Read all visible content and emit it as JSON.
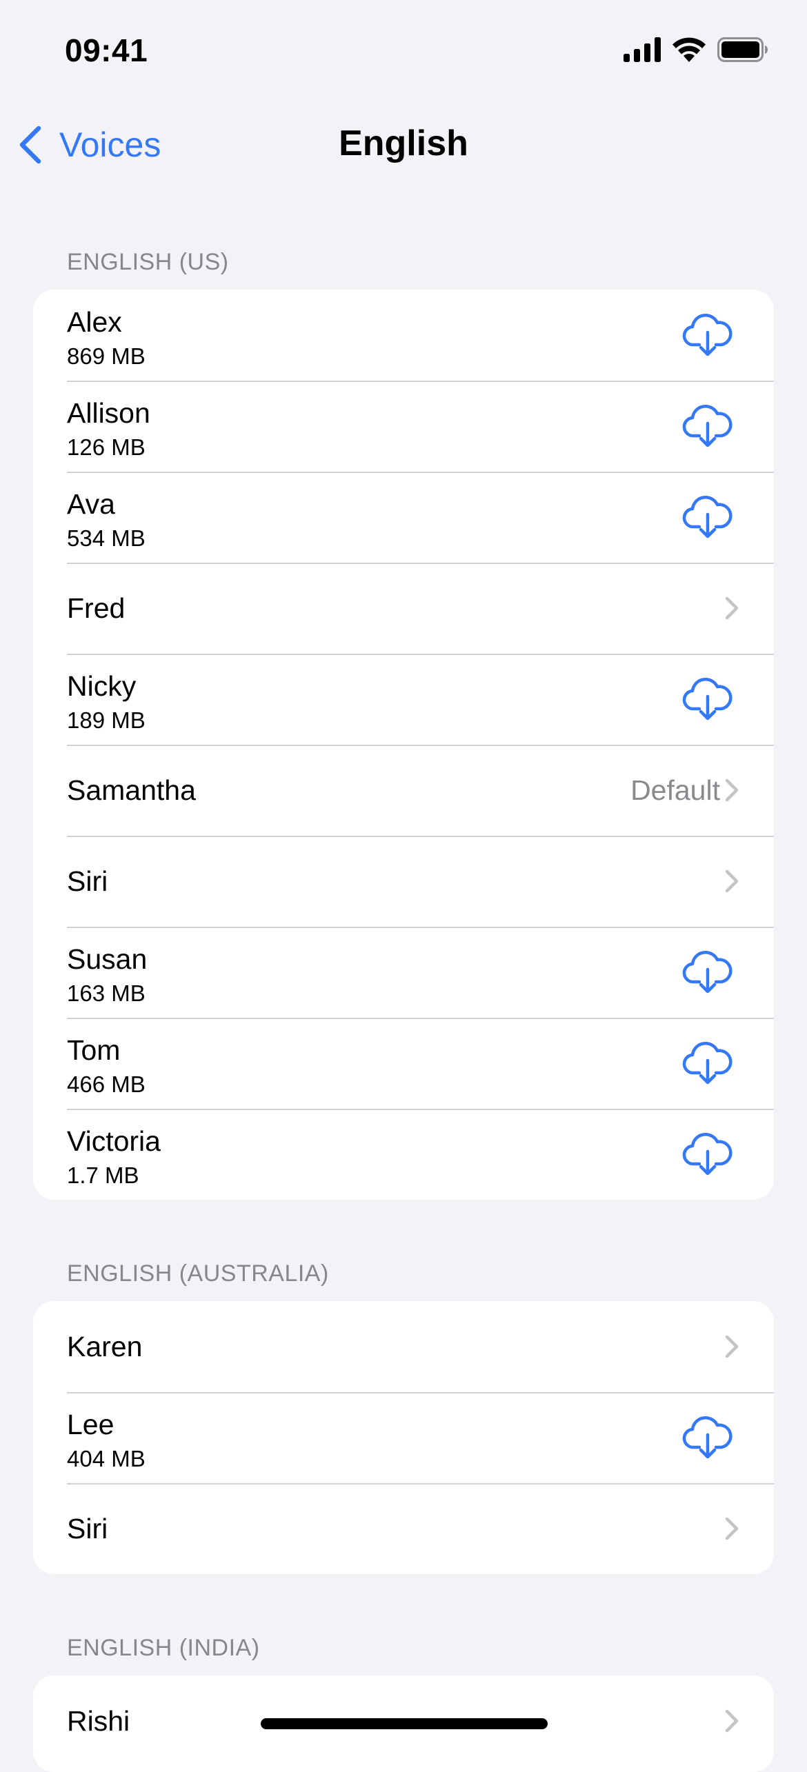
{
  "status_bar": {
    "time": "09:41",
    "icons": [
      "cellular-signal-icon",
      "wifi-icon",
      "battery-icon"
    ]
  },
  "nav": {
    "back_label": "Voices",
    "title": "English"
  },
  "colors": {
    "accent": "#3478f6",
    "background": "#f2f2f7",
    "secondary_text": "#8a8a8e",
    "separator": "#d1d1d6",
    "chevron": "#c4c4c7"
  },
  "sections": [
    {
      "header": "ENGLISH (US)",
      "voices": [
        {
          "name": "Alex",
          "size": "869 MB",
          "accessory": "download"
        },
        {
          "name": "Allison",
          "size": "126 MB",
          "accessory": "download"
        },
        {
          "name": "Ava",
          "size": "534 MB",
          "accessory": "download"
        },
        {
          "name": "Fred",
          "accessory": "chevron"
        },
        {
          "name": "Nicky",
          "size": "189 MB",
          "accessory": "download"
        },
        {
          "name": "Samantha",
          "detail": "Default",
          "accessory": "chevron"
        },
        {
          "name": "Siri",
          "accessory": "chevron"
        },
        {
          "name": "Susan",
          "size": "163 MB",
          "accessory": "download"
        },
        {
          "name": "Tom",
          "size": "466 MB",
          "accessory": "download"
        },
        {
          "name": "Victoria",
          "size": "1.7 MB",
          "accessory": "download"
        }
      ]
    },
    {
      "header": "ENGLISH (AUSTRALIA)",
      "voices": [
        {
          "name": "Karen",
          "accessory": "chevron"
        },
        {
          "name": "Lee",
          "size": "404 MB",
          "accessory": "download"
        },
        {
          "name": "Siri",
          "accessory": "chevron"
        }
      ]
    },
    {
      "header": "ENGLISH (INDIA)",
      "voices": [
        {
          "name": "Rishi",
          "accessory": "chevron"
        }
      ]
    }
  ]
}
